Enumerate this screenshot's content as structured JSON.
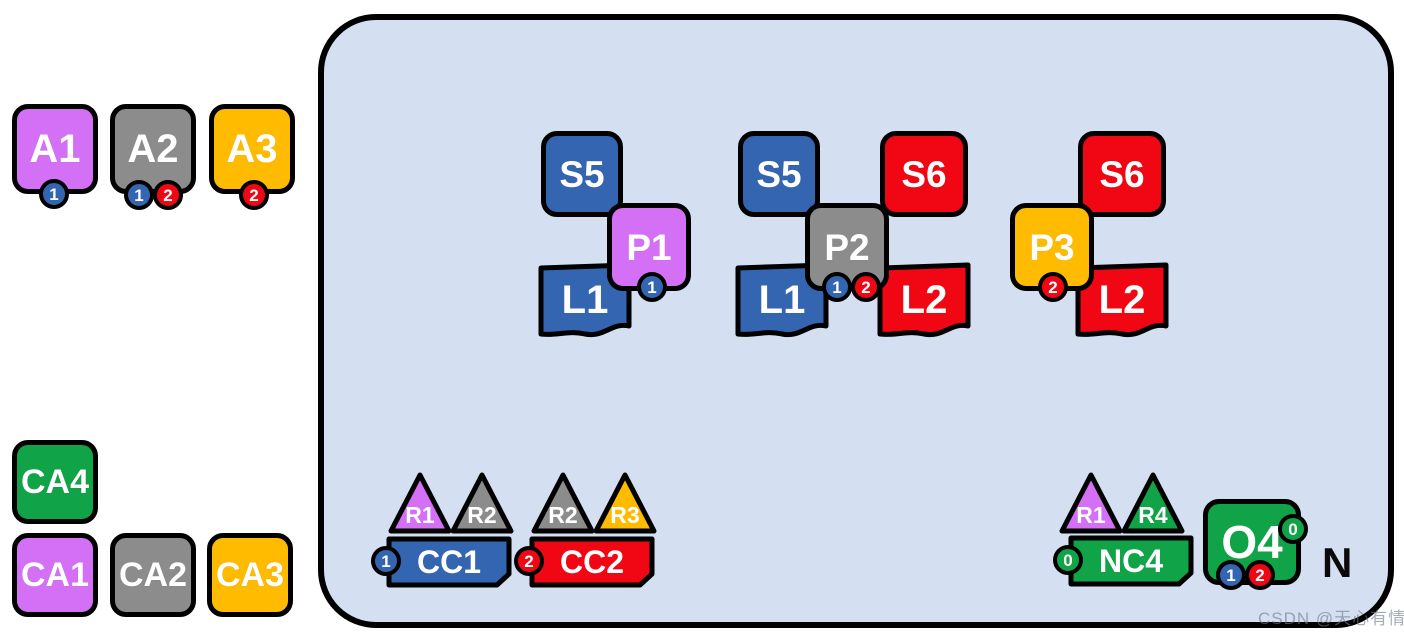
{
  "palette": {
    "purple": "#d470f5",
    "gray": "#8c8c8c",
    "gold": "#ffbb00",
    "blue": "#3465b0",
    "red": "#f00713",
    "green": "#11a347",
    "container_fill": "#d4dff1",
    "outline": "#000000",
    "page_bg": "#ffffff"
  },
  "container": {
    "name": "network-container",
    "label": "N"
  },
  "watermark": "CSDN @天心有情",
  "agents": [
    {
      "label": "A1",
      "color": "purple",
      "badges": [
        {
          "text": "1",
          "color": "blue"
        }
      ]
    },
    {
      "label": "A2",
      "color": "gray",
      "badges": [
        {
          "text": "1",
          "color": "blue"
        },
        {
          "text": "2",
          "color": "red"
        }
      ]
    },
    {
      "label": "A3",
      "color": "gold",
      "badges": [
        {
          "text": "2",
          "color": "red"
        }
      ]
    }
  ],
  "capabilities": [
    {
      "label": "CA4",
      "color": "green"
    },
    {
      "label": "CA1",
      "color": "purple"
    },
    {
      "label": "CA2",
      "color": "gray"
    },
    {
      "label": "CA3",
      "color": "gold"
    }
  ],
  "groups": [
    {
      "name": "group-p1",
      "services": [
        {
          "label": "S5",
          "color": "blue"
        }
      ],
      "logs": [
        {
          "label": "L1",
          "color": "blue"
        }
      ],
      "process": {
        "label": "P1",
        "color": "purple",
        "badges": [
          {
            "text": "1",
            "color": "blue"
          }
        ]
      }
    },
    {
      "name": "group-p2",
      "services": [
        {
          "label": "S5",
          "color": "blue"
        },
        {
          "label": "S6",
          "color": "red"
        }
      ],
      "logs": [
        {
          "label": "L1",
          "color": "blue"
        },
        {
          "label": "L2",
          "color": "red"
        }
      ],
      "process": {
        "label": "P2",
        "color": "gray",
        "badges": [
          {
            "text": "1",
            "color": "blue"
          },
          {
            "text": "2",
            "color": "red"
          }
        ]
      }
    },
    {
      "name": "group-p3",
      "services": [
        {
          "label": "S6",
          "color": "red"
        }
      ],
      "logs": [
        {
          "label": "L2",
          "color": "red"
        }
      ],
      "process": {
        "label": "P3",
        "color": "gold",
        "badges": [
          {
            "text": "2",
            "color": "red"
          }
        ]
      }
    }
  ],
  "clusters": [
    {
      "name": "cluster-cc1",
      "card": {
        "label": "CC1",
        "color": "blue"
      },
      "badge": {
        "text": "1",
        "color": "blue"
      },
      "roles": [
        {
          "label": "R1",
          "color": "purple"
        },
        {
          "label": "R2",
          "color": "gray"
        }
      ]
    },
    {
      "name": "cluster-cc2",
      "card": {
        "label": "CC2",
        "color": "red"
      },
      "badge": {
        "text": "2",
        "color": "red"
      },
      "roles": [
        {
          "label": "R2",
          "color": "gray"
        },
        {
          "label": "R3",
          "color": "gold"
        }
      ]
    },
    {
      "name": "cluster-nc4",
      "card": {
        "label": "NC4",
        "color": "green"
      },
      "badge": {
        "text": "0",
        "color": "green"
      },
      "roles": [
        {
          "label": "R1",
          "color": "purple"
        },
        {
          "label": "R4",
          "color": "green"
        }
      ]
    }
  ],
  "orchestrator": {
    "label": "O4",
    "color": "green",
    "side_badge": {
      "text": "0",
      "color": "green"
    },
    "badges": [
      {
        "text": "1",
        "color": "blue"
      },
      {
        "text": "2",
        "color": "red"
      }
    ]
  }
}
